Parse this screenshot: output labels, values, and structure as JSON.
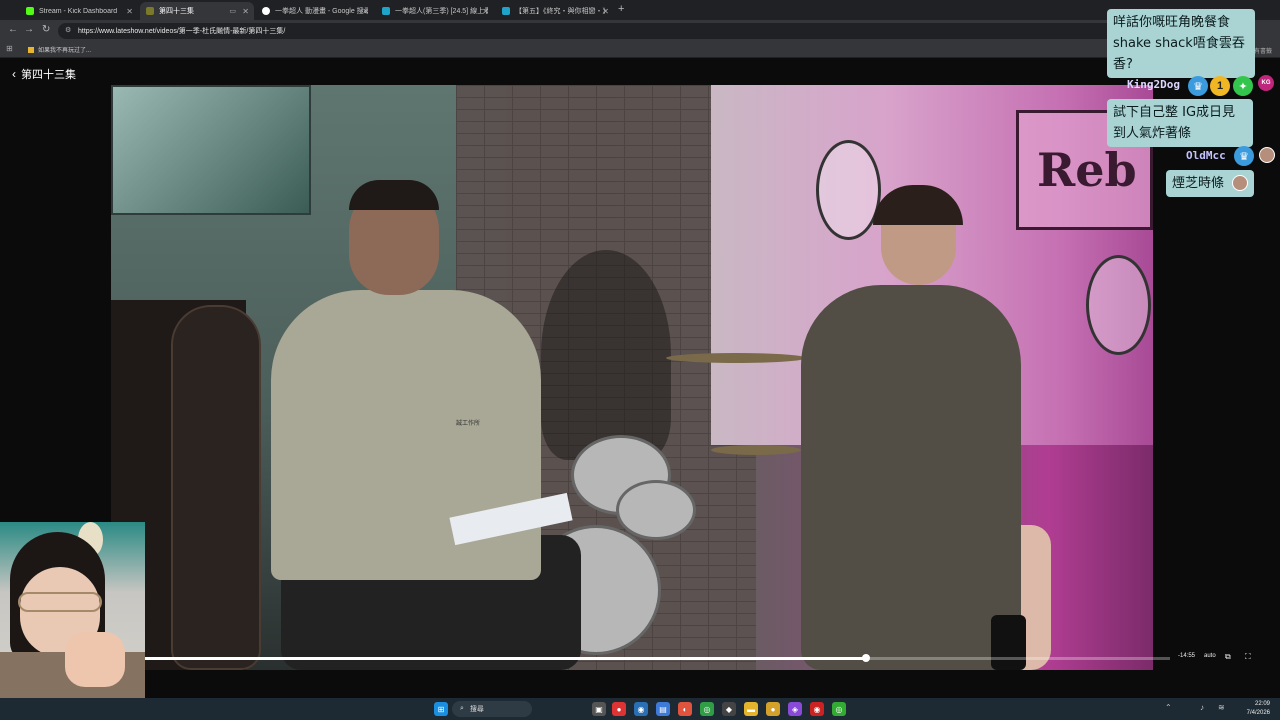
{
  "browser": {
    "tabs": [
      {
        "label": "Stream - Kick Dashboard",
        "color": "#53fc18"
      },
      {
        "label": "第四十三集",
        "color": "#7a7a2a",
        "active": true
      },
      {
        "label": "一拳超人 動漫畫 - Google 搜尋",
        "color": "#ffffff"
      },
      {
        "label": "一拳超人(第三季) [24.5] 線上看",
        "color": "#1fa3c9"
      },
      {
        "label": "【第五】《終究・與你相戀・》",
        "color": "#1fa3c9"
      }
    ],
    "new_tab": "+",
    "url": "https://www.lateshow.net/videos/第一季-杜氏飈情-最新/第四十三集/",
    "bookmark": "如果我不再玩过了...",
    "bookmark_right": "所有書籤"
  },
  "page": {
    "back_label": "第四十三集"
  },
  "video": {
    "sign_text": "Reb",
    "shirt_text": "誠工作所"
  },
  "player": {
    "progress": 0.703,
    "time": "-14:55",
    "quality": "auto"
  },
  "chat": [
    {
      "text": "咩話你嘅旺角晚餐食shake shack唔食雲吞香?"
    },
    {
      "user": "King2Dog",
      "user_color": "#dcd7ff",
      "badges": [
        "crown",
        "1",
        "star"
      ],
      "avatar": "KG",
      "text": "試下自己整 IG成日見到人氣炸著條"
    },
    {
      "user": "OldMcc",
      "user_color": "#c3c3ff",
      "badges": [
        "crown"
      ],
      "text": "煙芝時條"
    }
  ],
  "taskbar": {
    "search_label": "搜尋",
    "time": "22:09",
    "date": "7/4/2026"
  }
}
